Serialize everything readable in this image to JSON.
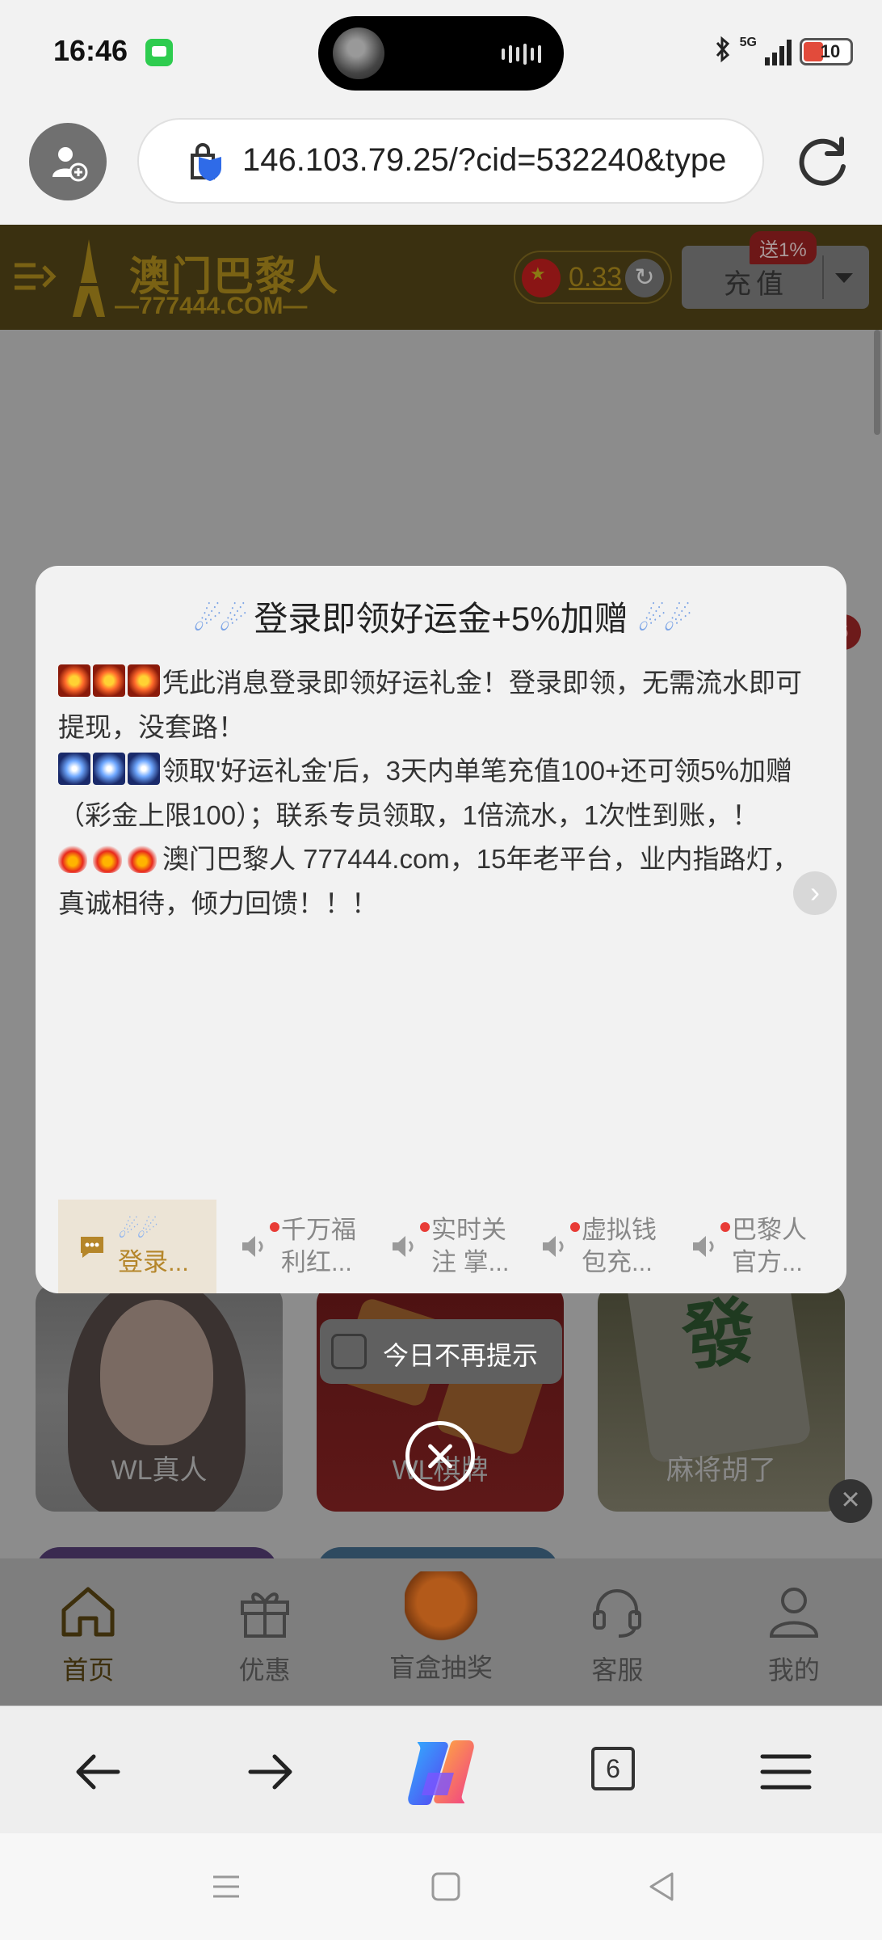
{
  "status_bar": {
    "time": "16:46",
    "network": "5G",
    "battery": "10"
  },
  "address_bar": {
    "url": "146.103.79.25/?cid=532240&type"
  },
  "site_header": {
    "logo_cn": "澳门巴黎人",
    "logo_domain": "—777444.COM—",
    "balance": "0.33",
    "recharge_label": "充值",
    "bonus_tag": "送1%"
  },
  "page_bg": {
    "side_badge": "6",
    "cards": [
      "WL真人",
      "WL棋牌",
      "麻将胡了"
    ]
  },
  "modal": {
    "title": "登录即领好运金+5%加赠",
    "paragraph1": "凭此消息登录即领好运礼金！登录即领，无需流水即可提现，没套路！",
    "paragraph2": "领取'好运礼金'后，3天内单笔充值100+还可领5%加赠（彩金上限100）；联系专员领取，1倍流水，1次性到账，！",
    "paragraph3": "澳门巴黎人  777444.com，15年老平台，业内指路灯，真诚相待，倾力回馈！！！",
    "tabs": [
      {
        "label": "登录...",
        "active": true
      },
      {
        "label": "千万福利红...",
        "active": false
      },
      {
        "label": "实时关注 掌...",
        "active": false
      },
      {
        "label": "虚拟钱包充...",
        "active": false
      },
      {
        "label": "巴黎人官方...",
        "active": false
      }
    ],
    "no_remind_label": "今日不再提示"
  },
  "bottom_nav": [
    {
      "label": "首页",
      "icon": "home-icon"
    },
    {
      "label": "优惠",
      "icon": "gift-icon"
    },
    {
      "label": "盲盒抽奖",
      "icon": "blind-box-icon"
    },
    {
      "label": "客服",
      "icon": "headset-icon"
    },
    {
      "label": "我的",
      "icon": "user-icon"
    }
  ],
  "browser_toolbar": {
    "tab_count": "6"
  },
  "colors": {
    "modal_bg": "#f2f2f2",
    "accent_gold": "#b5862a",
    "badge_red": "#e83b36",
    "title_deco_blue": "#7fa6e6"
  }
}
